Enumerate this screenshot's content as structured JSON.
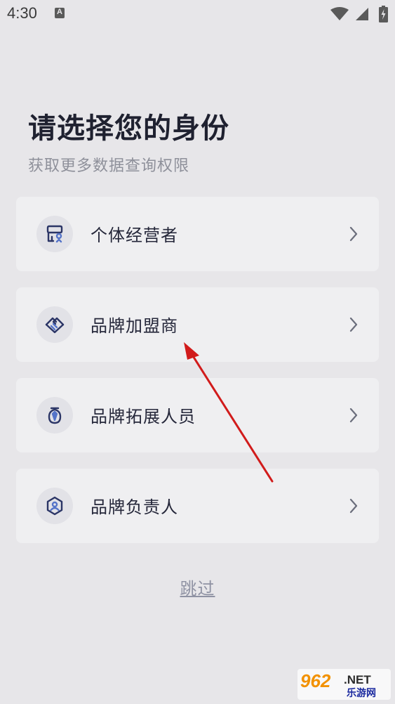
{
  "status_bar": {
    "time": "4:30",
    "icons": [
      "a-notification-icon",
      "wifi-icon",
      "signal-icon",
      "battery-icon"
    ]
  },
  "header": {
    "title": "请选择您的身份",
    "subtitle": "获取更多数据查询权限"
  },
  "roles": [
    {
      "label": "个体经营者",
      "icon": "store-icon"
    },
    {
      "label": "品牌加盟商",
      "icon": "handshake-icon"
    },
    {
      "label": "品牌拓展人员",
      "icon": "tie-badge-icon"
    },
    {
      "label": "品牌负责人",
      "icon": "hexagon-user-icon"
    }
  ],
  "skip": {
    "label": "跳过"
  },
  "watermark": {
    "main": "962",
    "net": ".NET",
    "sub": "乐游网"
  },
  "colors": {
    "background": "#e7e6e9",
    "card": "#efeff1",
    "icon_bg": "#e2e2e7",
    "icon_stroke": "#2b3566",
    "title": "#1f2130",
    "subtitle": "#8e909a",
    "skip": "#8f92a3",
    "arrow": "#d11b1b"
  }
}
